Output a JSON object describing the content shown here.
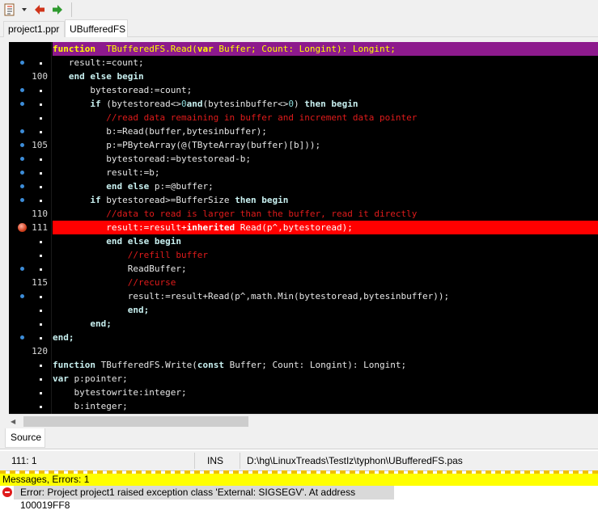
{
  "toolbar": {
    "icons": [
      "list-icon",
      "dropdown-icon",
      "back-arrow-icon",
      "forward-arrow-icon"
    ]
  },
  "tabs": [
    {
      "label": "project1.ppr"
    },
    {
      "label": "UBufferedFS"
    }
  ],
  "gutter": [
    {
      "dot": false,
      "num": ""
    },
    {
      "dot": true,
      "num": "."
    },
    {
      "dot": false,
      "num": "100"
    },
    {
      "dot": true,
      "num": "."
    },
    {
      "dot": true,
      "num": "."
    },
    {
      "dot": false,
      "num": "."
    },
    {
      "dot": true,
      "num": "."
    },
    {
      "dot": true,
      "num": "105"
    },
    {
      "dot": true,
      "num": "."
    },
    {
      "dot": true,
      "num": "."
    },
    {
      "dot": true,
      "num": "."
    },
    {
      "dot": true,
      "num": "."
    },
    {
      "dot": false,
      "num": "110"
    },
    {
      "dot": false,
      "num": "111",
      "error": true
    },
    {
      "dot": false,
      "num": "."
    },
    {
      "dot": false,
      "num": "."
    },
    {
      "dot": true,
      "num": "."
    },
    {
      "dot": false,
      "num": "115"
    },
    {
      "dot": true,
      "num": "."
    },
    {
      "dot": false,
      "num": "."
    },
    {
      "dot": false,
      "num": "."
    },
    {
      "dot": true,
      "num": "."
    },
    {
      "dot": false,
      "num": "120"
    },
    {
      "dot": false,
      "num": "."
    },
    {
      "dot": false,
      "num": "."
    },
    {
      "dot": false,
      "num": "."
    },
    {
      "dot": false,
      "num": "."
    }
  ],
  "code": [
    {
      "style": "purple",
      "parts": [
        [
          "kw",
          "function"
        ],
        [
          "",
          "  TBufferedFS.Read("
        ],
        [
          "kw",
          "var"
        ],
        [
          "",
          " Buffer; Count: Longint): Longint;"
        ]
      ]
    },
    {
      "parts": [
        [
          "",
          "   result:=count;"
        ]
      ]
    },
    {
      "parts": [
        [
          "",
          "   "
        ],
        [
          "kw",
          "end else begin"
        ]
      ]
    },
    {
      "parts": [
        [
          "",
          "       bytestoread:=count;"
        ]
      ]
    },
    {
      "parts": [
        [
          "",
          "       "
        ],
        [
          "kw",
          "if"
        ],
        [
          "",
          " (bytestoread<>"
        ],
        [
          "num",
          "0"
        ],
        [
          ")"
        ],
        [
          "kw",
          "and"
        ],
        [
          "",
          "(bytesinbuffer<>"
        ],
        [
          "num",
          "0"
        ],
        [
          "",
          ") "
        ],
        [
          "kw",
          "then begin"
        ]
      ]
    },
    {
      "parts": [
        [
          "cm",
          "          //read data remaining in buffer and increment data pointer"
        ]
      ]
    },
    {
      "parts": [
        [
          "",
          "          b:=Read(buffer,bytesinbuffer);"
        ]
      ]
    },
    {
      "parts": [
        [
          "",
          "          p:=PByteArray(@(TByteArray(buffer)[b]));"
        ]
      ]
    },
    {
      "parts": [
        [
          "",
          "          bytestoread:=bytestoread-b;"
        ]
      ]
    },
    {
      "parts": [
        [
          "",
          "          result:=b;"
        ]
      ]
    },
    {
      "parts": [
        [
          "",
          "          "
        ],
        [
          "kw",
          "end else"
        ],
        [
          "",
          " p:=@buffer;"
        ]
      ]
    },
    {
      "parts": [
        [
          "",
          "       "
        ],
        [
          "kw",
          "if"
        ],
        [
          "",
          " bytestoread>=BufferSize "
        ],
        [
          "kw",
          "then begin"
        ]
      ]
    },
    {
      "parts": [
        [
          "cm",
          "          //data to read is larger than the buffer, read it directly"
        ]
      ]
    },
    {
      "style": "red",
      "parts": [
        [
          "",
          "          result:=result+"
        ],
        [
          "kw",
          "inherited"
        ],
        [
          "",
          " Read(p^,bytestoread);"
        ]
      ]
    },
    {
      "parts": [
        [
          "",
          "          "
        ],
        [
          "kw",
          "end else begin"
        ]
      ]
    },
    {
      "parts": [
        [
          "cm",
          "              //refill buffer"
        ]
      ]
    },
    {
      "parts": [
        [
          "",
          "              ReadBuffer;"
        ]
      ]
    },
    {
      "parts": [
        [
          "cm",
          "              //recurse"
        ]
      ]
    },
    {
      "parts": [
        [
          "",
          "              result:=result+Read(p^,math.Min(bytestoread,bytesinbuffer));"
        ]
      ]
    },
    {
      "parts": [
        [
          "",
          "              "
        ],
        [
          "kw",
          "end;"
        ]
      ]
    },
    {
      "parts": [
        [
          "",
          "       "
        ],
        [
          "kw",
          "end;"
        ]
      ]
    },
    {
      "parts": [
        [
          "kw",
          "end;"
        ]
      ]
    },
    {
      "parts": [
        [
          "",
          ""
        ]
      ]
    },
    {
      "parts": [
        [
          "kw",
          "function"
        ],
        [
          "",
          " TBufferedFS.Write("
        ],
        [
          "kw",
          "const"
        ],
        [
          "",
          " Buffer; Count: Longint): Longint;"
        ]
      ]
    },
    {
      "parts": [
        [
          "kw",
          "var"
        ],
        [
          "",
          " p:pointer;"
        ]
      ]
    },
    {
      "parts": [
        [
          "",
          "    bytestowrite:integer;"
        ]
      ]
    },
    {
      "parts": [
        [
          "",
          "    b:integer;"
        ]
      ]
    }
  ],
  "source_tab": {
    "label": "Source"
  },
  "status": {
    "position": "111:  1",
    "mode": "INS",
    "path": "D:\\hg\\LinuxTreads\\TestIz\\typhon\\UBufferedFS.pas"
  },
  "messages": {
    "header": "Messages, Errors: 1",
    "items": [
      {
        "text": "Error: Project project1 raised exception class 'External: SIGSEGV'.  At address 100019FF8"
      }
    ]
  }
}
